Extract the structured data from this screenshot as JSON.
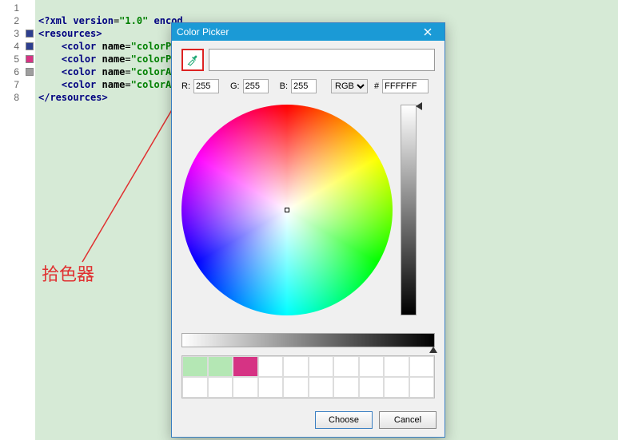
{
  "editor": {
    "lines": [
      "1",
      "2",
      "3",
      "4",
      "5",
      "6",
      "7",
      "8"
    ],
    "swatches": [
      null,
      null,
      "#2d3e8f",
      "#2d3e8f",
      "#d63384",
      "#9e9e9e",
      null,
      null
    ],
    "code": {
      "l1": "<?xml version=\"1.0\" encod",
      "l2": "<resources>",
      "l3a": "    <color name=",
      "l3b": "\"colorPrin",
      "l4a": "    <color name=",
      "l4b": "\"colorPrin",
      "l5a": "    <color name=",
      "l5b": "\"colorAcc",
      "l6a": "    <color name=",
      "l6b": "\"colorAcc",
      "l7": "</resources>"
    }
  },
  "dialog": {
    "title": "Color Picker",
    "r_label": "R:",
    "g_label": "G:",
    "b_label": "B:",
    "r": "255",
    "g": "255",
    "b": "255",
    "mode": "RGB",
    "hash": "#",
    "hex": "FFFFFF",
    "preset_swatches": [
      "#b4e7b4",
      "#b4e7b4",
      "#d63384"
    ],
    "choose": "Choose",
    "cancel": "Cancel"
  },
  "annotation": {
    "text": "拾色器"
  }
}
